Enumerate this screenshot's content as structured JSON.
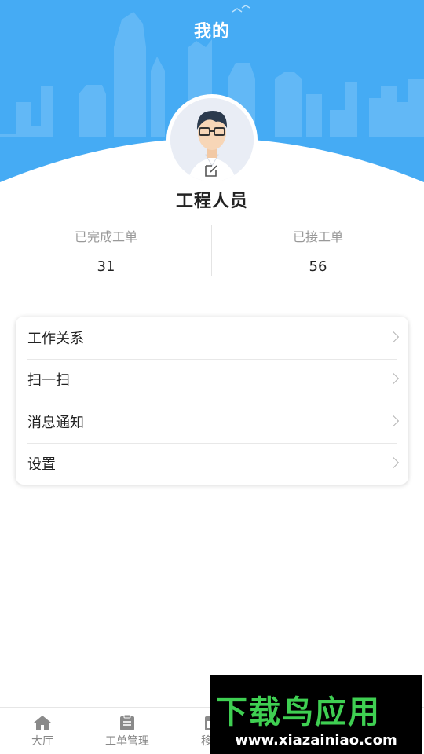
{
  "header": {
    "title": "我的"
  },
  "profile": {
    "name": "工程人员"
  },
  "stats": [
    {
      "label": "已完成工单",
      "value": "31"
    },
    {
      "label": "已接工单",
      "value": "56"
    }
  ],
  "menu": [
    {
      "label": "工作关系"
    },
    {
      "label": "扫一扫"
    },
    {
      "label": "消息通知"
    },
    {
      "label": "设置"
    }
  ],
  "tabbar": [
    {
      "label": "大厅",
      "icon": "home-icon"
    },
    {
      "label": "工单管理",
      "icon": "clipboard-icon"
    },
    {
      "label": "移动",
      "icon": "calendar-icon"
    }
  ],
  "watermark": {
    "brand": "下载鸟应用",
    "url": "www.xiazainiao.com"
  },
  "colors": {
    "header_blue": "#4aaef5",
    "skyline": "#7cc6f8",
    "text": "#222222",
    "muted": "#999999"
  }
}
